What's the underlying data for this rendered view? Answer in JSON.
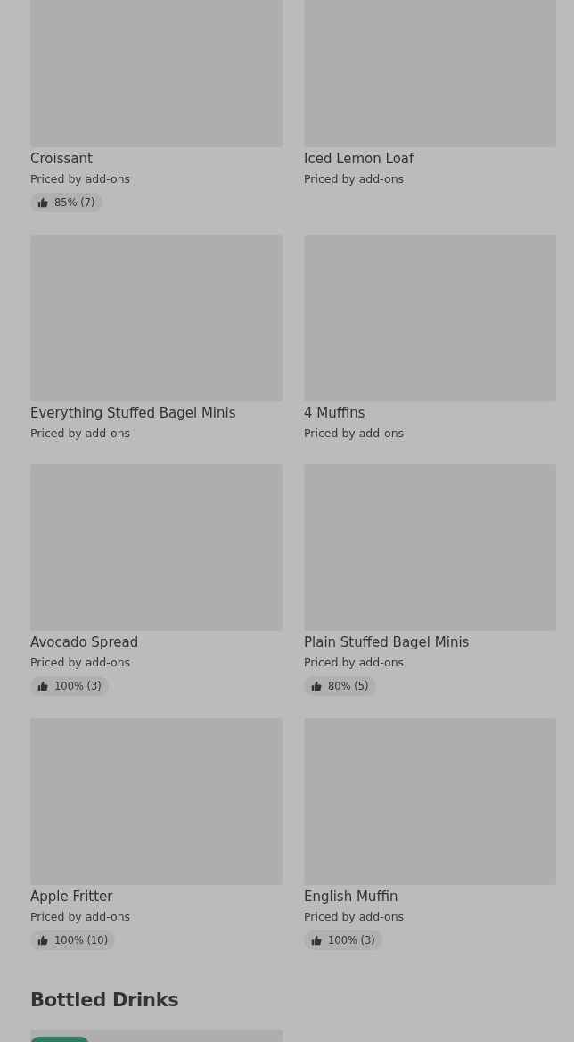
{
  "menu_sections": [
    {
      "items": [
        {
          "title": "Croissant",
          "subtitle": "Priced by add-ons",
          "rating": "85% (7)"
        },
        {
          "title": "Iced Lemon Loaf",
          "subtitle": "Priced by add-ons"
        },
        {
          "title": "Everything Stuffed Bagel Minis",
          "subtitle": "Priced by add-ons"
        },
        {
          "title": "4 Muffins",
          "subtitle": "Priced by add-ons"
        },
        {
          "title": "Avocado Spread",
          "subtitle": "Priced by add-ons",
          "rating": "100% (3)"
        },
        {
          "title": "Plain Stuffed Bagel Minis",
          "subtitle": "Priced by add-ons",
          "rating": "80% (5)"
        },
        {
          "title": "Apple Fritter",
          "subtitle": "Priced by add-ons",
          "rating": "100% (10)"
        },
        {
          "title": "English Muffin",
          "subtitle": "Priced by add-ons",
          "rating": "100% (3)"
        }
      ]
    },
    {
      "heading": "Bottled Drinks",
      "items": [
        {
          "tagged": true
        }
      ]
    }
  ]
}
